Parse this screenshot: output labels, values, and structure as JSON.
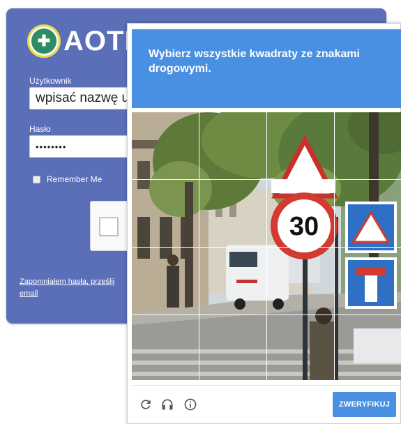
{
  "login": {
    "logo_text": "AOTM",
    "username_label": "Użytkownik",
    "username_value": "wpisać nazwę uż",
    "password_label": "Hasło",
    "password_value": "••••••••",
    "remember_label": "Remember Me",
    "forgot_link": "Zapomniałem hasła, prześlij email"
  },
  "challenge": {
    "instruction_prefix": "Wybierz wszystkie kwadraty ze ",
    "instruction_bold": "znakami drogowymi",
    "instruction_suffix": ".",
    "verify_button": "ZWERYFIKUJ",
    "footer_icons": [
      "reload-icon",
      "audio-icon",
      "info-icon"
    ],
    "grid_rows": 4,
    "grid_cols": 4
  },
  "scene": {
    "speed_limit": "30"
  },
  "colors": {
    "login_panel": "#5b6fb8",
    "challenge_header": "#4a90e2",
    "verify_button": "#4a90e2"
  }
}
